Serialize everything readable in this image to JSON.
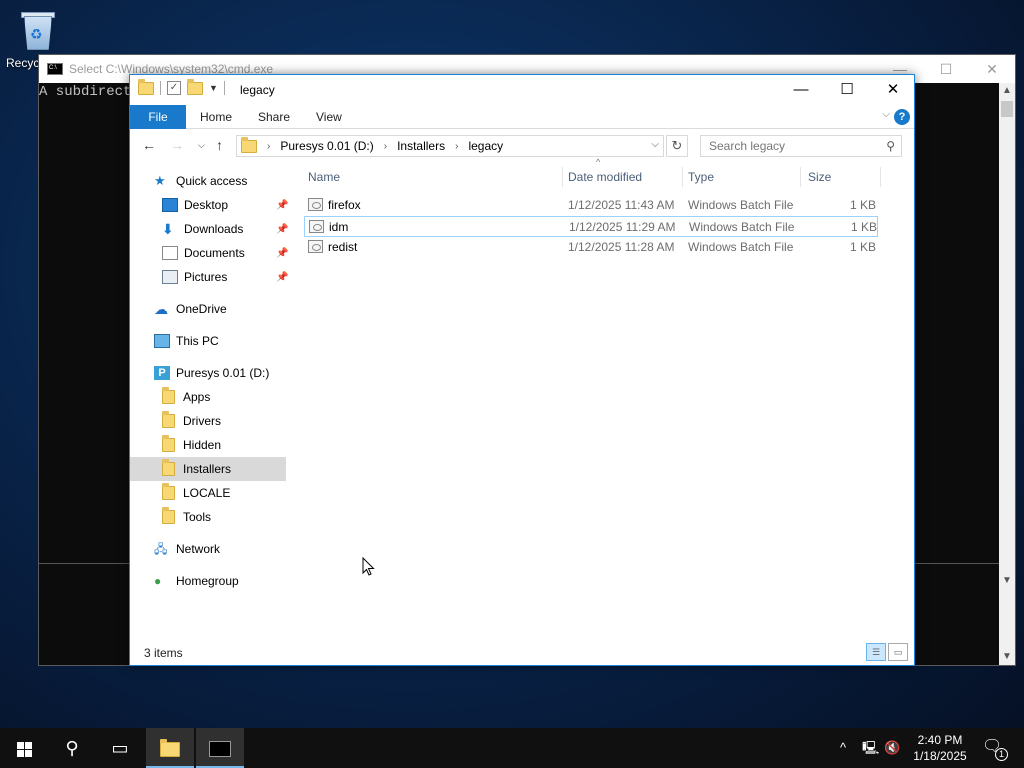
{
  "desktop": {
    "recycle_bin_label": "Recycle Bin"
  },
  "cmd": {
    "title": "Select C:\\Windows\\system32\\cmd.exe",
    "console_text": "A subdirecto",
    "min": "—",
    "max": "☐",
    "close": "✕"
  },
  "explorer": {
    "title": "legacy",
    "min": "—",
    "max": "☐",
    "close": "✕",
    "ribbon": {
      "file": "File",
      "home": "Home",
      "share": "Share",
      "view": "View",
      "help": "?"
    },
    "address": {
      "segments": [
        "Puresys 0.01 (D:)",
        "Installers",
        "legacy"
      ]
    },
    "search_placeholder": "Search legacy",
    "nav": {
      "quick_access": "Quick access",
      "desktop": "Desktop",
      "downloads": "Downloads",
      "documents": "Documents",
      "pictures": "Pictures",
      "onedrive": "OneDrive",
      "this_pc": "This PC",
      "drive": "Puresys 0.01 (D:)",
      "apps": "Apps",
      "drivers": "Drivers",
      "hidden": "Hidden",
      "installers": "Installers",
      "locale": "LOCALE",
      "tools": "Tools",
      "network": "Network",
      "homegroup": "Homegroup"
    },
    "columns": {
      "name": "Name",
      "date": "Date modified",
      "type": "Type",
      "size": "Size"
    },
    "files": [
      {
        "name": "firefox",
        "date": "1/12/2025 11:43 AM",
        "type": "Windows Batch File",
        "size": "1 KB"
      },
      {
        "name": "idm",
        "date": "1/12/2025 11:29 AM",
        "type": "Windows Batch File",
        "size": "1 KB"
      },
      {
        "name": "redist",
        "date": "1/12/2025 11:28 AM",
        "type": "Windows Batch File",
        "size": "1 KB"
      }
    ],
    "status": "3 items"
  },
  "taskbar": {
    "time": "2:40 PM",
    "date": "1/18/2025",
    "notification_count": "1"
  },
  "colors": {
    "accent": "#1979ca",
    "selection_border": "#99d1ff",
    "taskbar": "#101010"
  }
}
